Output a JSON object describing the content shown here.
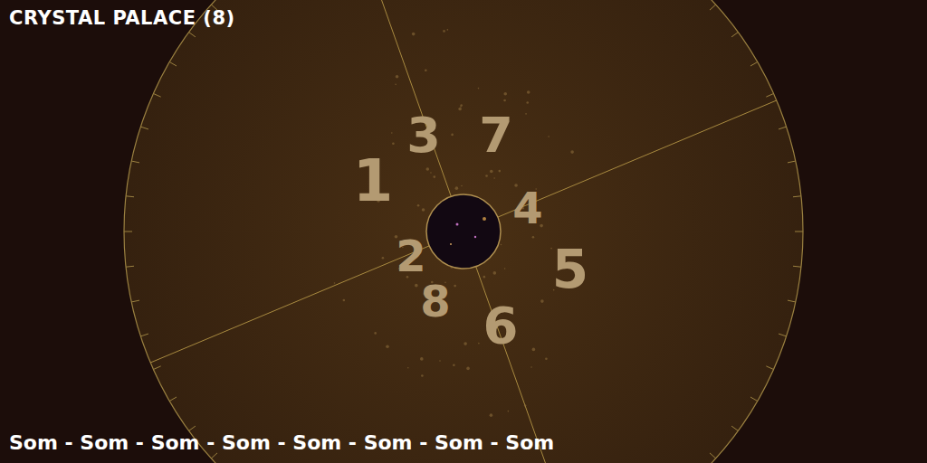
{
  "window": {
    "title": "CRYSTAL PALACE (8)"
  },
  "markers": [
    {
      "label": "1"
    },
    {
      "label": "3"
    },
    {
      "label": "7"
    },
    {
      "label": "4"
    },
    {
      "label": "5"
    },
    {
      "label": "6"
    },
    {
      "label": "8"
    },
    {
      "label": "2"
    }
  ],
  "footer": {
    "text": "Som - Som - Som - Som - Som - Som - Som - Som"
  }
}
